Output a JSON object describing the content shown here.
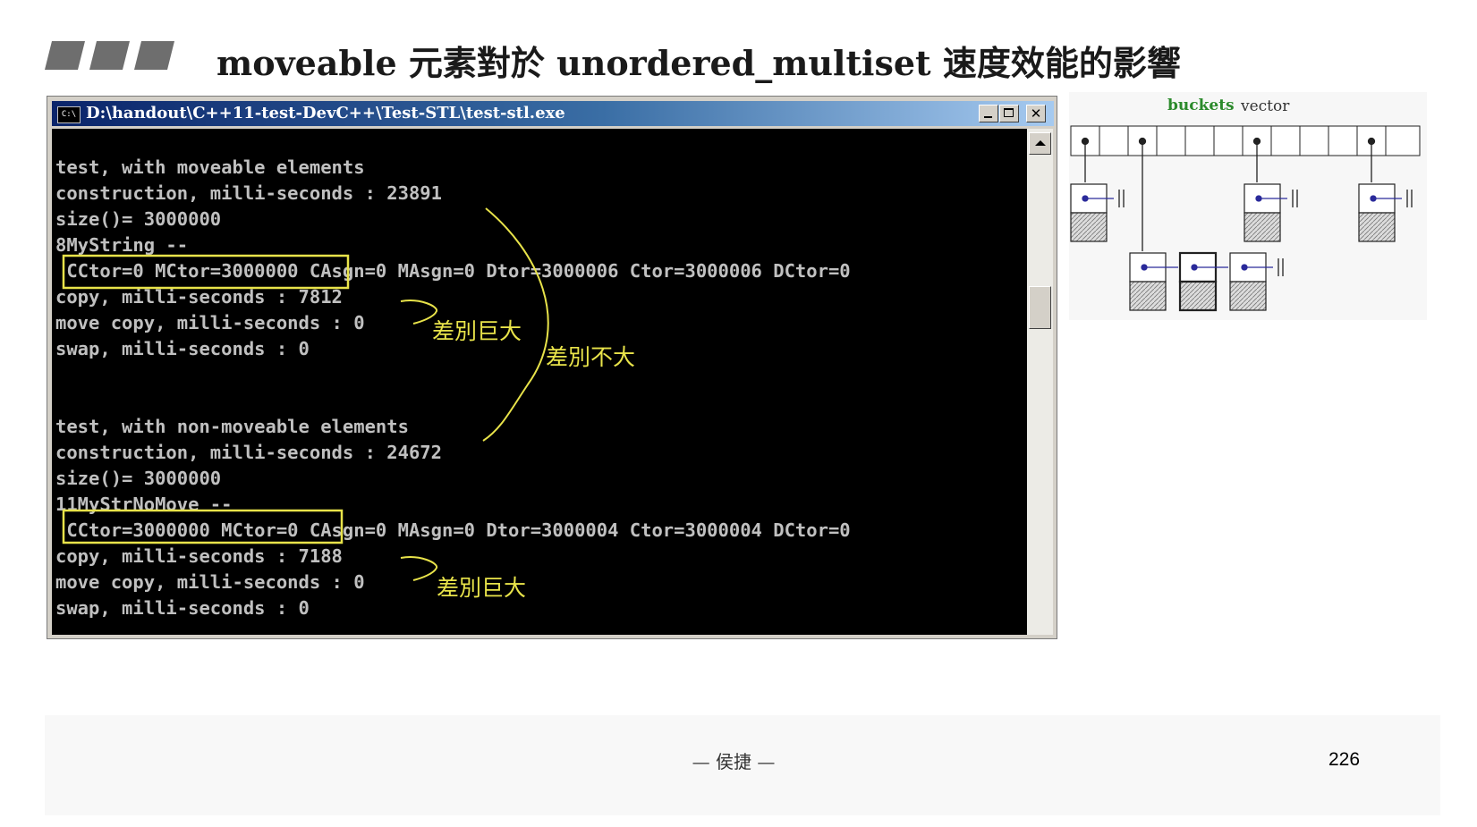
{
  "slide": {
    "title": "moveable 元素對於 unordered_multiset 速度效能的影響",
    "author": "— 侯捷 —",
    "page_number": "226"
  },
  "window": {
    "title": "D:\\handout\\C++11-test-DevC++\\Test-STL\\test-stl.exe",
    "icon_text": "C:\\"
  },
  "console": {
    "lines": [
      "",
      "test, with moveable elements",
      "construction, milli-seconds : 23891",
      "size()= 3000000",
      "8MyString --",
      " CCtor=0 MCtor=3000000 CAsgn=0 MAsgn=0 Dtor=3000006 Ctor=3000006 DCtor=0",
      "copy, milli-seconds : 7812",
      "move copy, milli-seconds : 0",
      "swap, milli-seconds : 0",
      "",
      "",
      "test, with non-moveable elements",
      "construction, milli-seconds : 24672",
      "size()= 3000000",
      "11MyStrNoMove --",
      " CCtor=3000000 MCtor=0 CAsgn=0 MAsgn=0 Dtor=3000004 Ctor=3000004 DCtor=0",
      "copy, milli-seconds : 7188",
      "move copy, milli-seconds : 0",
      "swap, milli-seconds : 0"
    ]
  },
  "annotations": {
    "big_diff_1": "差別巨大",
    "small_diff": "差別不大",
    "big_diff_2": "差別巨大"
  },
  "diagram": {
    "buckets_label": "buckets",
    "vector_label": "vector"
  },
  "colors": {
    "console_bg": "#000000",
    "console_text": "#c0c0c0",
    "annotation": "#e8e34a",
    "titlebar_start": "#0a246a",
    "titlebar_end": "#a6caf0",
    "buckets_label": "#2b8a2b"
  },
  "icons": [
    "console-app-icon",
    "minimize-icon",
    "maximize-icon",
    "close-icon",
    "scroll-up-arrow-icon"
  ]
}
